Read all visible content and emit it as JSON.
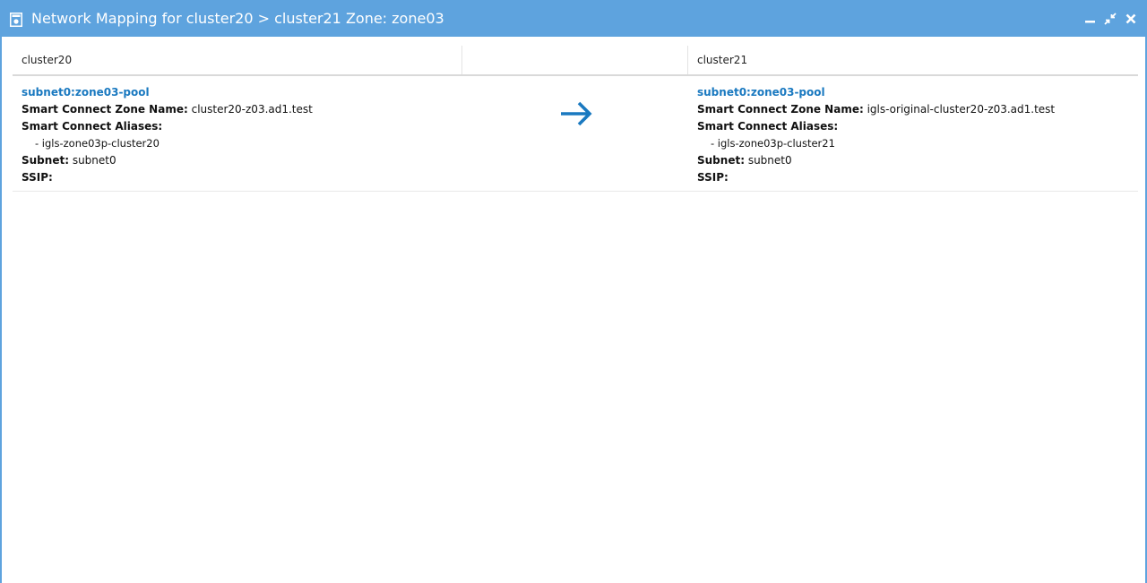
{
  "window": {
    "title": "Network Mapping for cluster20 > cluster21 Zone: zone03",
    "accent_color": "#5ea3de",
    "icons": [
      "window-icon",
      "minimize-icon",
      "restore-icon",
      "close-icon"
    ]
  },
  "table": {
    "columns": [
      "cluster20",
      "",
      "cluster21"
    ],
    "rows": [
      {
        "source": {
          "pool_name": "subnet0:zone03-pool",
          "zone_name_label": "Smart Connect Zone Name:",
          "zone_name": "cluster20-z03.ad1.test",
          "aliases_label": "Smart Connect Aliases:",
          "alias": "- igls-zone03p-cluster20",
          "subnet_label": "Subnet:",
          "subnet": "subnet0",
          "ssip_label": "SSIP:",
          "ssip": ""
        },
        "mapping_icon": "arrow-right-icon",
        "target": {
          "pool_name": "subnet0:zone03-pool",
          "zone_name_label": "Smart Connect Zone Name:",
          "zone_name": "igls-original-cluster20-z03.ad1.test",
          "aliases_label": "Smart Connect Aliases:",
          "alias": "- igls-zone03p-cluster21",
          "subnet_label": "Subnet:",
          "subnet": "subnet0",
          "ssip_label": "SSIP:",
          "ssip": ""
        }
      }
    ]
  }
}
